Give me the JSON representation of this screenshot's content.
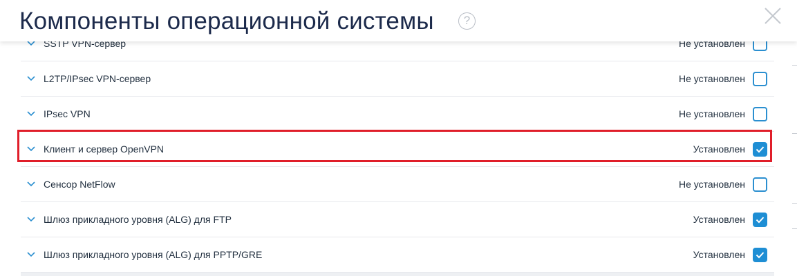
{
  "dialog": {
    "title": "Компоненты операционной системы",
    "help_glyph": "?",
    "close_icon": "close-icon"
  },
  "components": [
    {
      "name": "SSTP VPN-сервер",
      "status": "Не установлен",
      "checked": false
    },
    {
      "name": "L2TP/IPsec VPN-сервер",
      "status": "Не установлен",
      "checked": false
    },
    {
      "name": "IPsec VPN",
      "status": "Не установлен",
      "checked": false
    },
    {
      "name": "Клиент и сервер OpenVPN",
      "status": "Установлен",
      "checked": true
    },
    {
      "name": "Сенсор NetFlow",
      "status": "Не установлен",
      "checked": false
    },
    {
      "name": "Шлюз прикладного уровня (ALG) для FTP",
      "status": "Установлен",
      "checked": true
    },
    {
      "name": "Шлюз прикладного уровня (ALG) для PPTP/GRE",
      "status": "Установлен",
      "checked": true
    }
  ],
  "highlighted_component": "Клиент и сервер OpenVPN",
  "colors": {
    "title": "#1c2a4b",
    "checkbox_accent": "#1e8ed4",
    "highlight_border": "#e01e2a"
  }
}
